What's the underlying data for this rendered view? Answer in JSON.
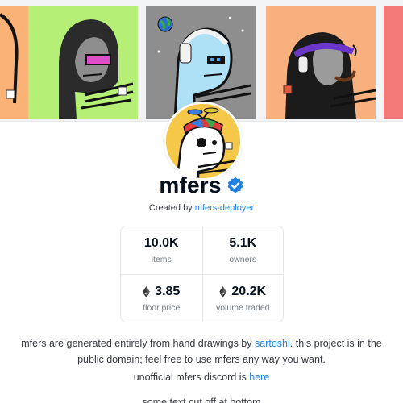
{
  "collection": {
    "name": "mfers",
    "created_prefix": "Created by",
    "creator": "mfers-deployer"
  },
  "stats": [
    {
      "value": "10.0K",
      "label": "items",
      "eth": false
    },
    {
      "value": "5.1K",
      "label": "owners",
      "eth": false
    },
    {
      "value": "3.85",
      "label": "floor price",
      "eth": true
    },
    {
      "value": "20.2K",
      "label": "volume traded",
      "eth": true
    }
  ],
  "description": {
    "part1": "mfers are generated entirely from hand drawings by",
    "link": "sartoshi",
    "part2": ". this project is in the public domain; feel free to use mfers any way you want."
  },
  "discord": {
    "prefix": "unofficial mfers discord is",
    "link": "here"
  },
  "cutoff_text": "some text cut off at bottom",
  "colors": {
    "accent": "#2081e2",
    "verified": "#2081e2",
    "tile_orange": "#fbb276",
    "tile_green": "#b5ef75",
    "tile_gray": "#909090",
    "tile_salmon": "#f8b07e",
    "tile_red": "#f47a7a",
    "avatar_yellow": "#f6c84a"
  },
  "icons": [
    "verified-badge-icon",
    "ethereum-icon"
  ]
}
